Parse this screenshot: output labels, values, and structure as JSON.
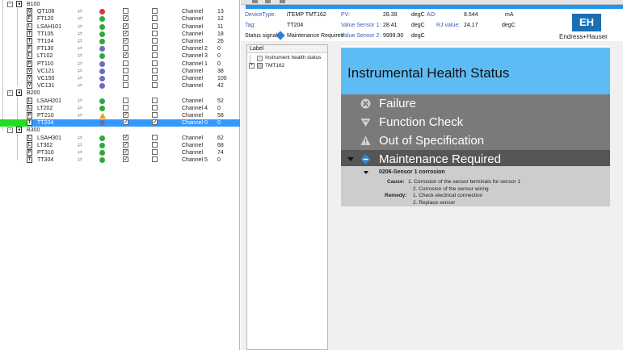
{
  "tree": {
    "rows": [
      {
        "kind": "group",
        "label": "B100",
        "expanded": true
      },
      {
        "kind": "device",
        "type_letter": "Q",
        "tag": "QT106",
        "status": "fail",
        "cb1": false,
        "cb2": false,
        "channel": "Channel",
        "value": "13"
      },
      {
        "kind": "device",
        "type_letter": "F",
        "tag": "FT120",
        "status": "ok",
        "cb1": true,
        "cb2": false,
        "channel": "Channel",
        "value": "12"
      },
      {
        "kind": "device",
        "type_letter": "L",
        "tag": "LSAH101",
        "status": "ok",
        "cb1": true,
        "cb2": false,
        "channel": "Channel",
        "value": "11"
      },
      {
        "kind": "device",
        "type_letter": "T",
        "tag": "TT105",
        "status": "ok",
        "cb1": true,
        "cb2": false,
        "channel": "Channel",
        "value": "18"
      },
      {
        "kind": "device",
        "type_letter": "T",
        "tag": "TT104",
        "status": "ok",
        "cb1": true,
        "cb2": false,
        "channel": "Channel",
        "value": "26"
      },
      {
        "kind": "device",
        "type_letter": "F",
        "tag": "FT130",
        "status": "maint",
        "cb1": false,
        "cb2": false,
        "channel": "Channel 2",
        "value": "0"
      },
      {
        "kind": "device",
        "type_letter": "L",
        "tag": "LT102",
        "status": "ok",
        "cb1": true,
        "cb2": false,
        "channel": "Channel 3",
        "value": "0"
      },
      {
        "kind": "device",
        "type_letter": "P",
        "tag": "PT110",
        "status": "maint",
        "cb1": false,
        "cb2": false,
        "channel": "Channel 1",
        "value": "0"
      },
      {
        "kind": "device",
        "type_letter": "V",
        "tag": "VC121",
        "status": "maint",
        "cb1": false,
        "cb2": false,
        "channel": "Channel",
        "value": "38"
      },
      {
        "kind": "device",
        "type_letter": "V",
        "tag": "VC150",
        "status": "maint",
        "cb1": false,
        "cb2": false,
        "channel": "Channel",
        "value": "100"
      },
      {
        "kind": "device",
        "type_letter": "V",
        "tag": "VC131",
        "status": "maint",
        "cb1": false,
        "cb2": false,
        "channel": "Channel",
        "value": "42"
      },
      {
        "kind": "group",
        "label": "B200",
        "expanded": true
      },
      {
        "kind": "device",
        "type_letter": "L",
        "tag": "LSAH201",
        "status": "ok",
        "cb1": false,
        "cb2": false,
        "channel": "Channel",
        "value": "52"
      },
      {
        "kind": "device",
        "type_letter": "L",
        "tag": "LT202",
        "status": "ok",
        "cb1": false,
        "cb2": false,
        "channel": "Channel 4",
        "value": "0"
      },
      {
        "kind": "device",
        "type_letter": "P",
        "tag": "PT210",
        "status": "warn",
        "cb1": true,
        "cb2": false,
        "channel": "Channel",
        "value": "58"
      },
      {
        "kind": "device",
        "type_letter": "T",
        "tag": "TT204",
        "status": "maint",
        "cb1": true,
        "cb2": true,
        "channel": "Channel 0",
        "value": "0",
        "selected": true
      },
      {
        "kind": "group",
        "label": "B300",
        "expanded": true
      },
      {
        "kind": "device",
        "type_letter": "L",
        "tag": "LSAH301",
        "status": "ok",
        "cb1": true,
        "cb2": false,
        "channel": "Channel",
        "value": "62"
      },
      {
        "kind": "device",
        "type_letter": "L",
        "tag": "LT302",
        "status": "ok",
        "cb1": true,
        "cb2": false,
        "channel": "Channel",
        "value": "68"
      },
      {
        "kind": "device",
        "type_letter": "P",
        "tag": "PT310",
        "status": "ok",
        "cb1": true,
        "cb2": false,
        "channel": "Channel",
        "value": "74"
      },
      {
        "kind": "device",
        "type_letter": "T",
        "tag": "TT304",
        "status": "ok",
        "cb1": true,
        "cb2": false,
        "channel": "Channel 5",
        "value": "0"
      }
    ]
  },
  "device_info": {
    "device_type_key": "DeviceType:",
    "device_type_val": "iTEMP TMT162",
    "tag_key": "Tag:",
    "tag_val": "TT204",
    "status_key": "Status signal",
    "status_val": "Maintenance Required",
    "pv_key": "PV:",
    "pv_val": "28.39",
    "pv_unit": "degC",
    "vs1_key": "Value Sensor 1:",
    "vs1_val": "28.41",
    "vs1_unit": "degC",
    "vs2_key": "Value Sensor 2:",
    "vs2_val": "9999.90",
    "vs2_unit": "degC",
    "ao_key": "AO:",
    "ao_val": "8.544",
    "ao_unit": "mA",
    "rj_key": "RJ value:",
    "rj_val": "24.17",
    "rj_unit": "degC"
  },
  "brand": {
    "logo": "EH",
    "name": "Endress+Hauser"
  },
  "label_tree": {
    "header": "Label",
    "item1": "Instrument health status",
    "item2": "TMT162"
  },
  "health": {
    "title": "Instrumental Health Status",
    "categories": [
      {
        "label": "Failure",
        "icon": "failure-x-icon"
      },
      {
        "label": "Function Check",
        "icon": "function-check-icon"
      },
      {
        "label": "Out of Specification",
        "icon": "out-of-spec-warning-icon"
      },
      {
        "label": "Maintenance Required",
        "icon": "maintenance-icon",
        "active": true
      }
    ],
    "diagnostic": {
      "code": "0206-Sensor 1 corrosion",
      "cause_label": "Cause:",
      "cause_1": "1. Corrosion of the sensor terminals for sensor 1",
      "cause_2": "2. Corrosion of the sensor wiring",
      "remedy_label": "Remedy:",
      "remedy_1": "1. Check electrical connection",
      "remedy_2": "2. Replace sensor"
    }
  },
  "colors": {
    "accent": "#1e96f0",
    "header_bg": "#5ebcf5",
    "panel_dark": "#7a7a7a",
    "selection": "#3399ff",
    "marker": "#22dd22"
  }
}
